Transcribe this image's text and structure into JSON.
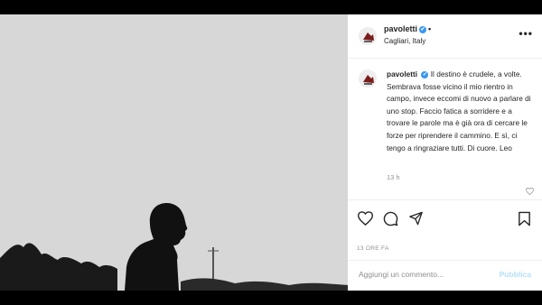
{
  "post": {
    "username": "pavoletti",
    "verified_mark": "✔",
    "header_dot": "•",
    "location": "Cagliari, Italy",
    "more_label": "•••",
    "caption_user": "pavoletti",
    "caption_text": "Il destino è crudele, a volte. Sembrava fosse vicino il mio rientro in campo, invece eccomi di nuovo a parlare di uno stop. Faccio fatica a sorridere e a trovare le parole ma è già ora di cercare le forze per riprendere il cammino. E sì, ci tengo a ringraziare tutti. Di cuore. Leo",
    "caption_time": "13 h",
    "post_age": "13 ORE FA"
  },
  "comment": {
    "placeholder": "Aggiungi un commento...",
    "publish_label": "Pubblica"
  },
  "icons": {
    "like": "heart-icon",
    "comment": "comment-icon",
    "share": "share-icon",
    "save": "bookmark-icon",
    "more": "more-icon",
    "verified": "verified-badge-icon"
  },
  "colors": {
    "verified_blue": "#3897f0",
    "publish_disabled": "#b2dffc",
    "muted_text": "#8e8e8e"
  }
}
